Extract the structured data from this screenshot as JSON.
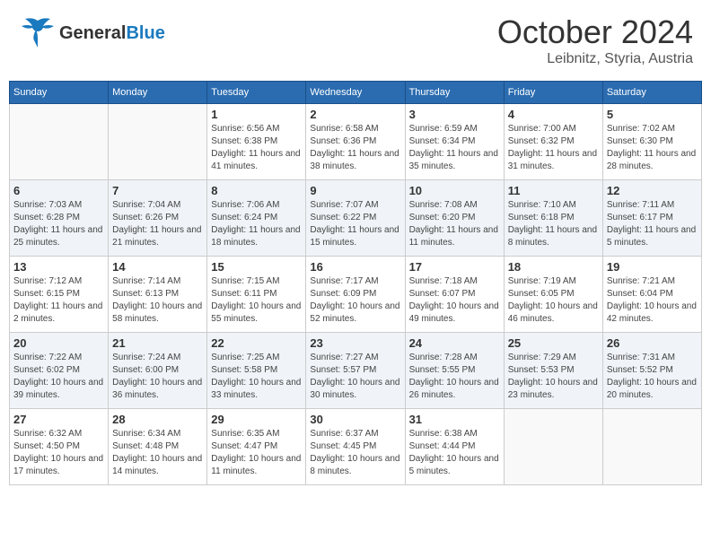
{
  "header": {
    "logo_general": "General",
    "logo_blue": "Blue",
    "month_title": "October 2024",
    "location": "Leibnitz, Styria, Austria"
  },
  "weekdays": [
    "Sunday",
    "Monday",
    "Tuesday",
    "Wednesday",
    "Thursday",
    "Friday",
    "Saturday"
  ],
  "weeks": [
    [
      {
        "day": "",
        "info": ""
      },
      {
        "day": "",
        "info": ""
      },
      {
        "day": "1",
        "info": "Sunrise: 6:56 AM\nSunset: 6:38 PM\nDaylight: 11 hours and 41 minutes."
      },
      {
        "day": "2",
        "info": "Sunrise: 6:58 AM\nSunset: 6:36 PM\nDaylight: 11 hours and 38 minutes."
      },
      {
        "day": "3",
        "info": "Sunrise: 6:59 AM\nSunset: 6:34 PM\nDaylight: 11 hours and 35 minutes."
      },
      {
        "day": "4",
        "info": "Sunrise: 7:00 AM\nSunset: 6:32 PM\nDaylight: 11 hours and 31 minutes."
      },
      {
        "day": "5",
        "info": "Sunrise: 7:02 AM\nSunset: 6:30 PM\nDaylight: 11 hours and 28 minutes."
      }
    ],
    [
      {
        "day": "6",
        "info": "Sunrise: 7:03 AM\nSunset: 6:28 PM\nDaylight: 11 hours and 25 minutes."
      },
      {
        "day": "7",
        "info": "Sunrise: 7:04 AM\nSunset: 6:26 PM\nDaylight: 11 hours and 21 minutes."
      },
      {
        "day": "8",
        "info": "Sunrise: 7:06 AM\nSunset: 6:24 PM\nDaylight: 11 hours and 18 minutes."
      },
      {
        "day": "9",
        "info": "Sunrise: 7:07 AM\nSunset: 6:22 PM\nDaylight: 11 hours and 15 minutes."
      },
      {
        "day": "10",
        "info": "Sunrise: 7:08 AM\nSunset: 6:20 PM\nDaylight: 11 hours and 11 minutes."
      },
      {
        "day": "11",
        "info": "Sunrise: 7:10 AM\nSunset: 6:18 PM\nDaylight: 11 hours and 8 minutes."
      },
      {
        "day": "12",
        "info": "Sunrise: 7:11 AM\nSunset: 6:17 PM\nDaylight: 11 hours and 5 minutes."
      }
    ],
    [
      {
        "day": "13",
        "info": "Sunrise: 7:12 AM\nSunset: 6:15 PM\nDaylight: 11 hours and 2 minutes."
      },
      {
        "day": "14",
        "info": "Sunrise: 7:14 AM\nSunset: 6:13 PM\nDaylight: 10 hours and 58 minutes."
      },
      {
        "day": "15",
        "info": "Sunrise: 7:15 AM\nSunset: 6:11 PM\nDaylight: 10 hours and 55 minutes."
      },
      {
        "day": "16",
        "info": "Sunrise: 7:17 AM\nSunset: 6:09 PM\nDaylight: 10 hours and 52 minutes."
      },
      {
        "day": "17",
        "info": "Sunrise: 7:18 AM\nSunset: 6:07 PM\nDaylight: 10 hours and 49 minutes."
      },
      {
        "day": "18",
        "info": "Sunrise: 7:19 AM\nSunset: 6:05 PM\nDaylight: 10 hours and 46 minutes."
      },
      {
        "day": "19",
        "info": "Sunrise: 7:21 AM\nSunset: 6:04 PM\nDaylight: 10 hours and 42 minutes."
      }
    ],
    [
      {
        "day": "20",
        "info": "Sunrise: 7:22 AM\nSunset: 6:02 PM\nDaylight: 10 hours and 39 minutes."
      },
      {
        "day": "21",
        "info": "Sunrise: 7:24 AM\nSunset: 6:00 PM\nDaylight: 10 hours and 36 minutes."
      },
      {
        "day": "22",
        "info": "Sunrise: 7:25 AM\nSunset: 5:58 PM\nDaylight: 10 hours and 33 minutes."
      },
      {
        "day": "23",
        "info": "Sunrise: 7:27 AM\nSunset: 5:57 PM\nDaylight: 10 hours and 30 minutes."
      },
      {
        "day": "24",
        "info": "Sunrise: 7:28 AM\nSunset: 5:55 PM\nDaylight: 10 hours and 26 minutes."
      },
      {
        "day": "25",
        "info": "Sunrise: 7:29 AM\nSunset: 5:53 PM\nDaylight: 10 hours and 23 minutes."
      },
      {
        "day": "26",
        "info": "Sunrise: 7:31 AM\nSunset: 5:52 PM\nDaylight: 10 hours and 20 minutes."
      }
    ],
    [
      {
        "day": "27",
        "info": "Sunrise: 6:32 AM\nSunset: 4:50 PM\nDaylight: 10 hours and 17 minutes."
      },
      {
        "day": "28",
        "info": "Sunrise: 6:34 AM\nSunset: 4:48 PM\nDaylight: 10 hours and 14 minutes."
      },
      {
        "day": "29",
        "info": "Sunrise: 6:35 AM\nSunset: 4:47 PM\nDaylight: 10 hours and 11 minutes."
      },
      {
        "day": "30",
        "info": "Sunrise: 6:37 AM\nSunset: 4:45 PM\nDaylight: 10 hours and 8 minutes."
      },
      {
        "day": "31",
        "info": "Sunrise: 6:38 AM\nSunset: 4:44 PM\nDaylight: 10 hours and 5 minutes."
      },
      {
        "day": "",
        "info": ""
      },
      {
        "day": "",
        "info": ""
      }
    ]
  ]
}
